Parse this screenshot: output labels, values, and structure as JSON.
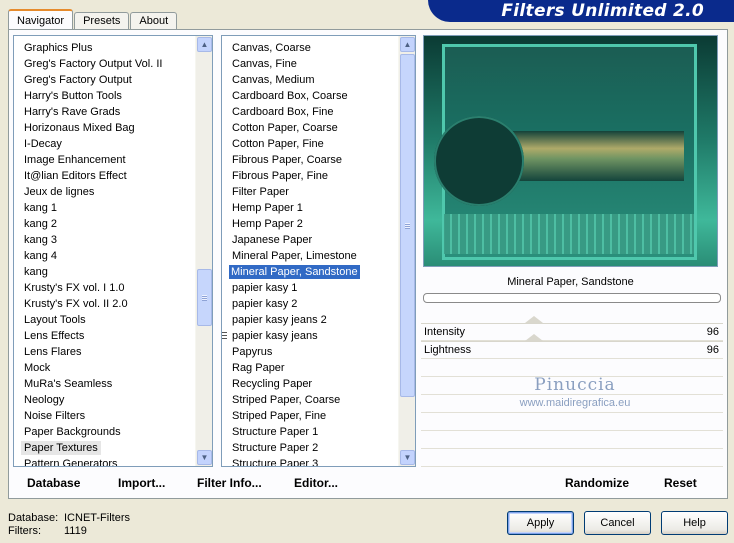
{
  "tabs": [
    {
      "label": "Navigator",
      "active": true
    },
    {
      "label": "Presets"
    },
    {
      "label": "About"
    }
  ],
  "app_title": "Filters Unlimited 2.0",
  "categories": {
    "selected": "Paper Textures",
    "items": [
      "Graphics Plus",
      "Greg's Factory Output Vol. II",
      "Greg's Factory Output",
      "Harry's Button Tools",
      "Harry's Rave Grads",
      "Horizonaus Mixed Bag",
      "I-Decay",
      "Image Enhancement",
      "It@lian Editors Effect",
      "Jeux de lignes",
      "kang 1",
      "kang 2",
      "kang 3",
      "kang 4",
      "kang",
      "Krusty's FX vol. I 1.0",
      "Krusty's FX vol. II 2.0",
      "Layout Tools",
      "Lens Effects",
      "Lens Flares",
      "Mock",
      "MuRa's Seamless",
      "Neology",
      "Noise Filters",
      "Paper Backgrounds",
      "Paper Textures",
      "Pattern Generators"
    ]
  },
  "filters": {
    "selected": "Mineral Paper, Sandstone",
    "marked": "papier kasy jeans",
    "items": [
      "Canvas, Coarse",
      "Canvas, Fine",
      "Canvas, Medium",
      "Cardboard Box, Coarse",
      "Cardboard Box, Fine",
      "Cotton Paper, Coarse",
      "Cotton Paper, Fine",
      "Fibrous Paper, Coarse",
      "Fibrous Paper, Fine",
      "Filter Paper",
      "Hemp Paper 1",
      "Hemp Paper 2",
      "Japanese Paper",
      "Mineral Paper, Limestone",
      "Mineral Paper, Sandstone",
      "papier kasy 1",
      "papier kasy 2",
      "papier kasy jeans 2",
      "papier kasy jeans",
      "Papyrus",
      "Rag Paper",
      "Recycling Paper",
      "Striped Paper, Coarse",
      "Striped Paper, Fine",
      "Structure Paper 1",
      "Structure Paper 2",
      "Structure Paper 3"
    ]
  },
  "preview": {
    "filter_name": "Mineral Paper, Sandstone"
  },
  "parameters": [
    {
      "label": "Intensity",
      "value": "96"
    },
    {
      "label": "Lightness",
      "value": "96"
    }
  ],
  "watermark": {
    "line1": "Pinuccia",
    "line2": "www.maidiregrafica.eu"
  },
  "toolbar": {
    "database": "Database",
    "import": "Import...",
    "filter_info": "Filter Info...",
    "editor": "Editor...",
    "randomize": "Randomize",
    "reset": "Reset"
  },
  "status": {
    "database_label": "Database:",
    "database_value": "ICNET-Filters",
    "filters_label": "Filters:",
    "filters_value": "1119"
  },
  "buttons": {
    "apply": "Apply",
    "cancel": "Cancel",
    "help": "Help"
  },
  "colors": {
    "selection": "#316ac5",
    "title_banner": "#0a2a8c",
    "tab_accent": "#e68b2c"
  }
}
